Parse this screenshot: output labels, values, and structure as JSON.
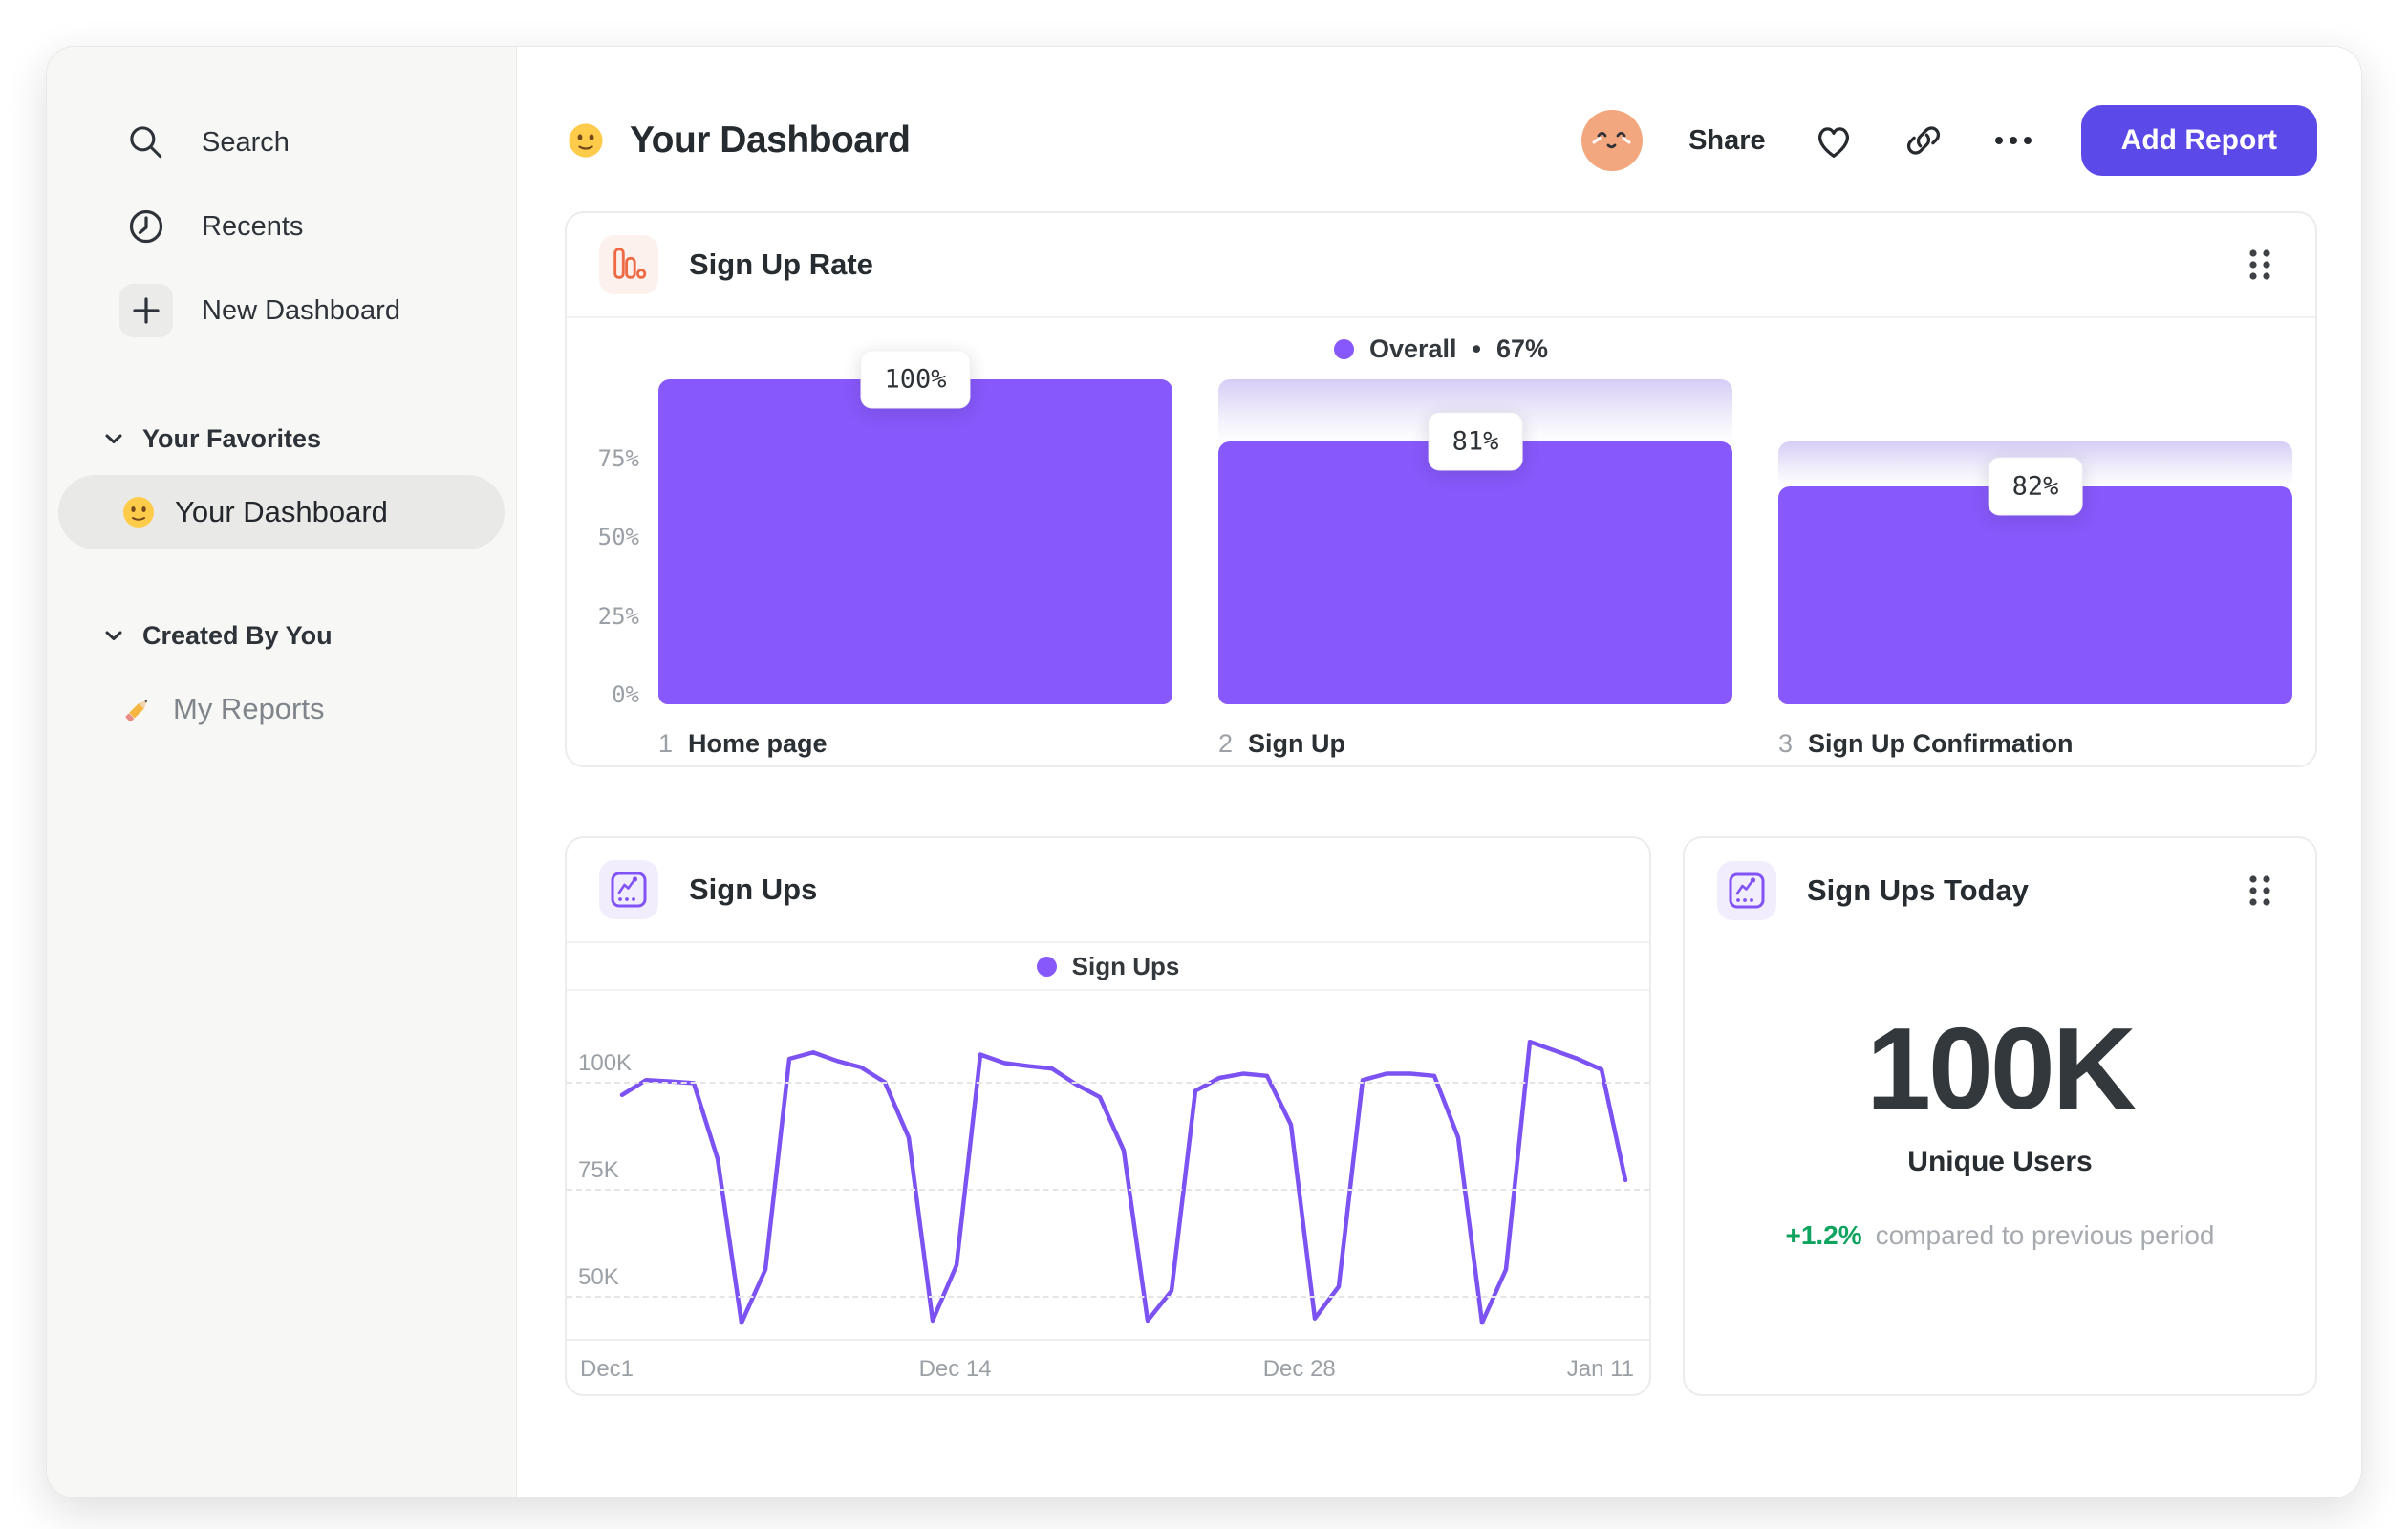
{
  "colors": {
    "accent_button": "#5B4AE8",
    "funnel_bar": "#8758FB",
    "legend_dot": "#8758FB",
    "line_stroke": "#7C53F2",
    "delta_green": "#0EA35F",
    "funnel_card_icon_orange": "#ED6A45",
    "line_card_icon_purple": "#8152F5",
    "avatar_bg": "#F2A77E"
  },
  "sidebar": {
    "top_items": [
      {
        "icon": "search-icon",
        "label": "Search"
      },
      {
        "icon": "clock-icon",
        "label": "Recents"
      },
      {
        "icon": "plus-icon",
        "label": "New Dashboard"
      }
    ],
    "sections": [
      {
        "label": "Your Favorites",
        "items": [
          {
            "icon": "smiley-emoji-icon",
            "label": "Your Dashboard",
            "selected": true
          }
        ]
      },
      {
        "label": "Created By You",
        "items": [
          {
            "icon": "pencil-emoji-icon",
            "label": "My Reports",
            "selected": false
          }
        ]
      }
    ]
  },
  "header": {
    "emoji": "smiley",
    "title": "Your Dashboard",
    "share_label": "Share",
    "add_report_label": "Add Report"
  },
  "chart_data": [
    {
      "type": "bar",
      "variant": "funnel",
      "title": "Sign Up Rate",
      "legend": {
        "label": "Overall",
        "separator": "•",
        "value": "67%"
      },
      "legend_position": "top-center",
      "grid": false,
      "ylim": [
        0,
        100
      ],
      "y_ticks": [
        {
          "label": "75%",
          "value": 75
        },
        {
          "label": "50%",
          "value": 50
        },
        {
          "label": "25%",
          "value": 25
        },
        {
          "label": "0%",
          "value": 0
        }
      ],
      "categories": [
        "Home page",
        "Sign Up",
        "Sign Up Confirmation"
      ],
      "values": [
        100,
        81,
        82
      ],
      "overall_conversion": 67,
      "steps": [
        {
          "number": "1",
          "label": "Home page",
          "conversion_label": "100%",
          "solid_pct": 100,
          "ghost_from_pct": 100
        },
        {
          "number": "2",
          "label": "Sign Up",
          "conversion_label": "81%",
          "solid_pct": 81,
          "ghost_from_pct": 100
        },
        {
          "number": "3",
          "label": "Sign Up Confirmation",
          "conversion_label": "82%",
          "solid_pct": 67,
          "ghost_from_pct": 81
        }
      ]
    },
    {
      "type": "line",
      "title": "Sign Ups",
      "legend": {
        "label": "Sign Ups"
      },
      "legend_position": "top-center",
      "grid": "horizontal-dashed",
      "unit": "K",
      "ylim_k": [
        40,
        114
      ],
      "gridlines": [
        {
          "label": "100K",
          "value": 100
        },
        {
          "label": "75K",
          "value": 75
        },
        {
          "label": "50K",
          "value": 50
        }
      ],
      "x_ticks": [
        {
          "label": "Dec1",
          "pos": 0
        },
        {
          "label": "Dec 14",
          "pos": 0.332
        },
        {
          "label": "Dec 28",
          "pos": 0.675
        },
        {
          "label": "Jan 11",
          "pos": 1
        }
      ],
      "values_k": [
        97,
        100.5,
        100.2,
        99.8,
        82,
        43.5,
        56,
        105.5,
        107,
        105,
        103.5,
        100,
        87,
        44,
        57,
        106.5,
        104.5,
        103.8,
        103.2,
        99.5,
        96.5,
        84,
        44,
        51,
        98,
        101,
        102,
        101.5,
        90,
        44.5,
        52,
        100.5,
        102,
        102,
        101.5,
        87,
        43.5,
        56,
        109.5,
        107.5,
        105.5,
        103,
        77
      ]
    },
    {
      "type": "kpi",
      "title": "Sign Ups Today",
      "value": "100K",
      "label": "Unique Users",
      "delta": "+1.2%",
      "delta_note": "compared to previous period"
    }
  ]
}
